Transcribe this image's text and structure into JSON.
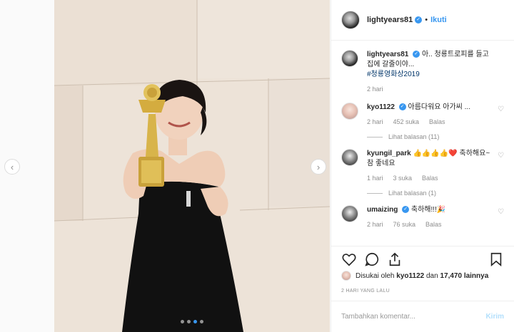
{
  "post": {
    "author": "lightyears81",
    "follow_label": "Ikuti",
    "separator": "•",
    "carousel_count": 4,
    "carousel_active": 3
  },
  "comments": [
    {
      "user": "lightyears81",
      "text": "아.. 청룡트로피를 들고 집에 갈줄이야...",
      "hashtag": "#청룡영화상2019",
      "time": "2 hari",
      "verified": true
    },
    {
      "user": "kyo1122",
      "text": "아름다워요 아가씨 ...",
      "time": "2 hari",
      "likes": "452 suka",
      "reply_label": "Balas",
      "view_replies": "Lihat balasan (11)",
      "verified": true
    },
    {
      "user": "kyungil_park",
      "text": "👍👍👍👍❤️ 축하해요~ 참 좋네요",
      "time": "1 hari",
      "likes": "3 suka",
      "reply_label": "Balas",
      "view_replies": "Lihat balasan (1)",
      "verified": false
    },
    {
      "user": "umaizing",
      "text": "축하해!!!🎉",
      "time": "2 hari",
      "likes": "76 suka",
      "reply_label": "Balas",
      "verified": true
    }
  ],
  "likes_line": {
    "prefix": "Disukai oleh ",
    "user": "kyo1122",
    "middle": " dan ",
    "count": "17,470 lainnya"
  },
  "timestamp": "2 HARI YANG LALU",
  "add_comment": {
    "placeholder": "Tambahkan komentar...",
    "send_label": "Kirim"
  },
  "icons": [
    "chevron-left-icon",
    "chevron-right-icon",
    "heart-icon",
    "comment-icon",
    "share-icon",
    "bookmark-icon",
    "verified-badge-icon"
  ],
  "colors": {
    "accent": "#3897f0",
    "send_disabled": "#b2dffc",
    "muted": "#8e8e8e"
  }
}
